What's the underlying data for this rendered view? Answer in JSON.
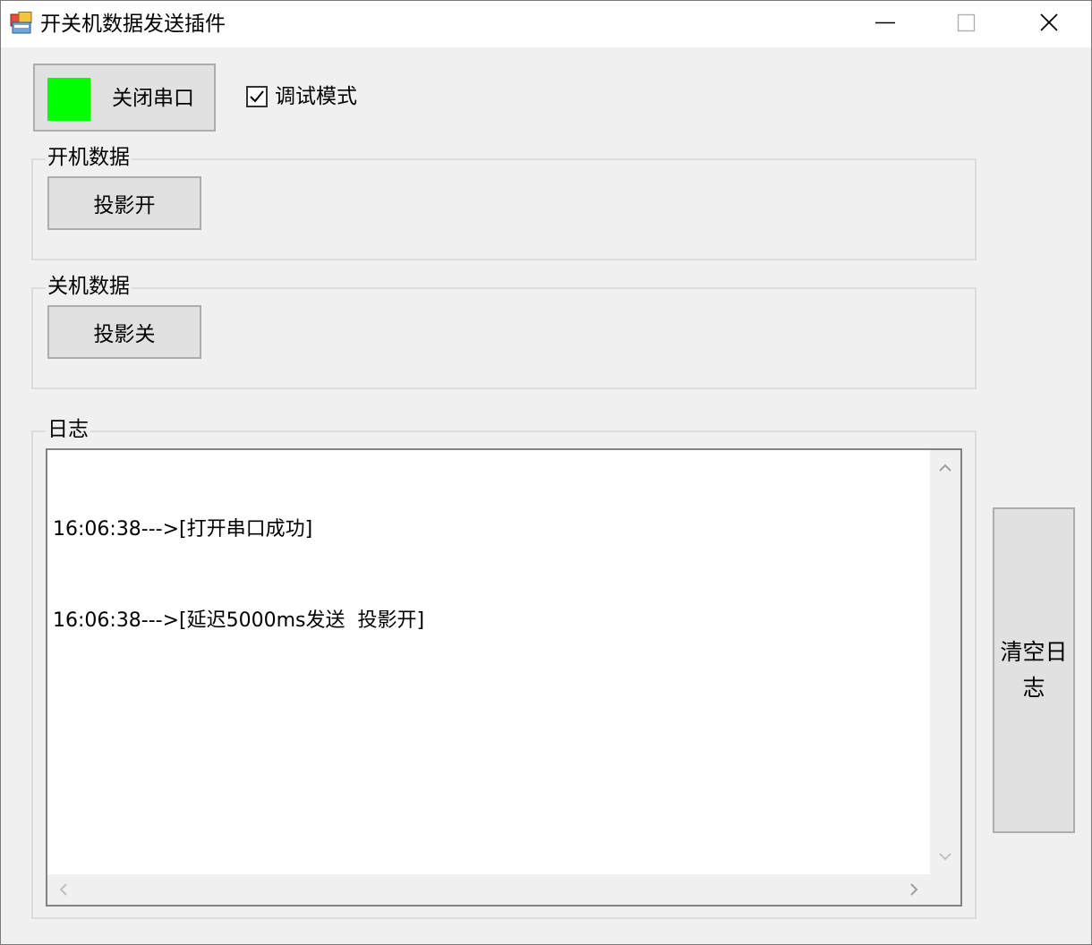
{
  "window": {
    "title": "开关机数据发送插件"
  },
  "serial": {
    "button_label": "关闭串口",
    "status_color": "#00ff00"
  },
  "debug": {
    "label": "调试模式",
    "checked": true
  },
  "power_on": {
    "group_label": "开机数据",
    "button_label": "投影开"
  },
  "power_off": {
    "group_label": "关机数据",
    "button_label": "投影关"
  },
  "log": {
    "group_label": "日志",
    "lines": [
      "16:06:38--->[打开串口成功]",
      "16:06:38--->[延迟5000ms发送  投影开]"
    ],
    "clear_button_label": "清空日志"
  },
  "icons": {
    "app": "app-window-icon",
    "minimize": "minimize-icon",
    "maximize": "maximize-icon",
    "close": "close-icon"
  }
}
